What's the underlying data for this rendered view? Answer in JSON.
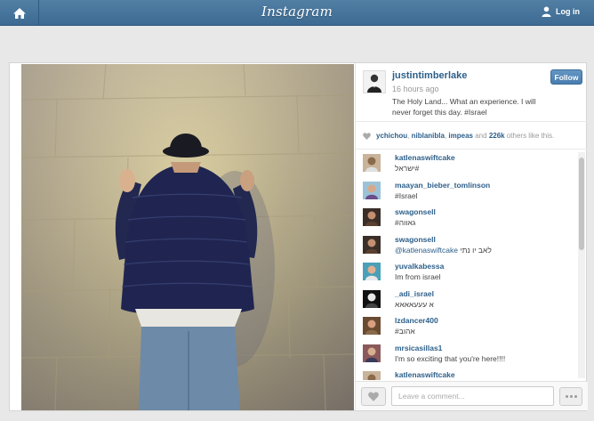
{
  "topbar": {
    "logo": "Instagram",
    "login_label": "Log in",
    "home_icon": "home-icon",
    "user_icon": "user-icon",
    "color": "#517fa4"
  },
  "post": {
    "username": "justintimberlake",
    "time": "16 hours ago",
    "caption": "The Holy Land... What an experience. I will never forget this day. #Israel",
    "follow_label": "Follow",
    "likes": {
      "users": [
        "ychichou",
        "niblanibla",
        "impeas"
      ],
      "sep1": ",",
      "sep2": ",",
      "and": "and",
      "count": "226k",
      "suffix": "others like this."
    },
    "comments": [
      {
        "user": "katlenaswiftcake",
        "text": "ישראל#"
      },
      {
        "user": "maayan_bieber_tomlinson",
        "text": "#Israel"
      },
      {
        "user": "swagonsell",
        "text": "#גאווה"
      },
      {
        "user": "swagonsell",
        "mention": "@katlenaswiftcake",
        "text": "לאב יו נתי"
      },
      {
        "user": "yuvalkabessa",
        "text": "Im from israel"
      },
      {
        "user": "_adi_israel",
        "text": "א עעעאאאא"
      },
      {
        "user": "lzdancer400",
        "text": "#אהוב"
      },
      {
        "user": "mrsicasillas1",
        "text": "I'm so exciting that you're here!!!!"
      },
      {
        "user": "katlenaswiftcake",
        "text": ""
      }
    ],
    "comment_placeholder": "Leave a comment...",
    "accent": "#2c5f8a"
  }
}
